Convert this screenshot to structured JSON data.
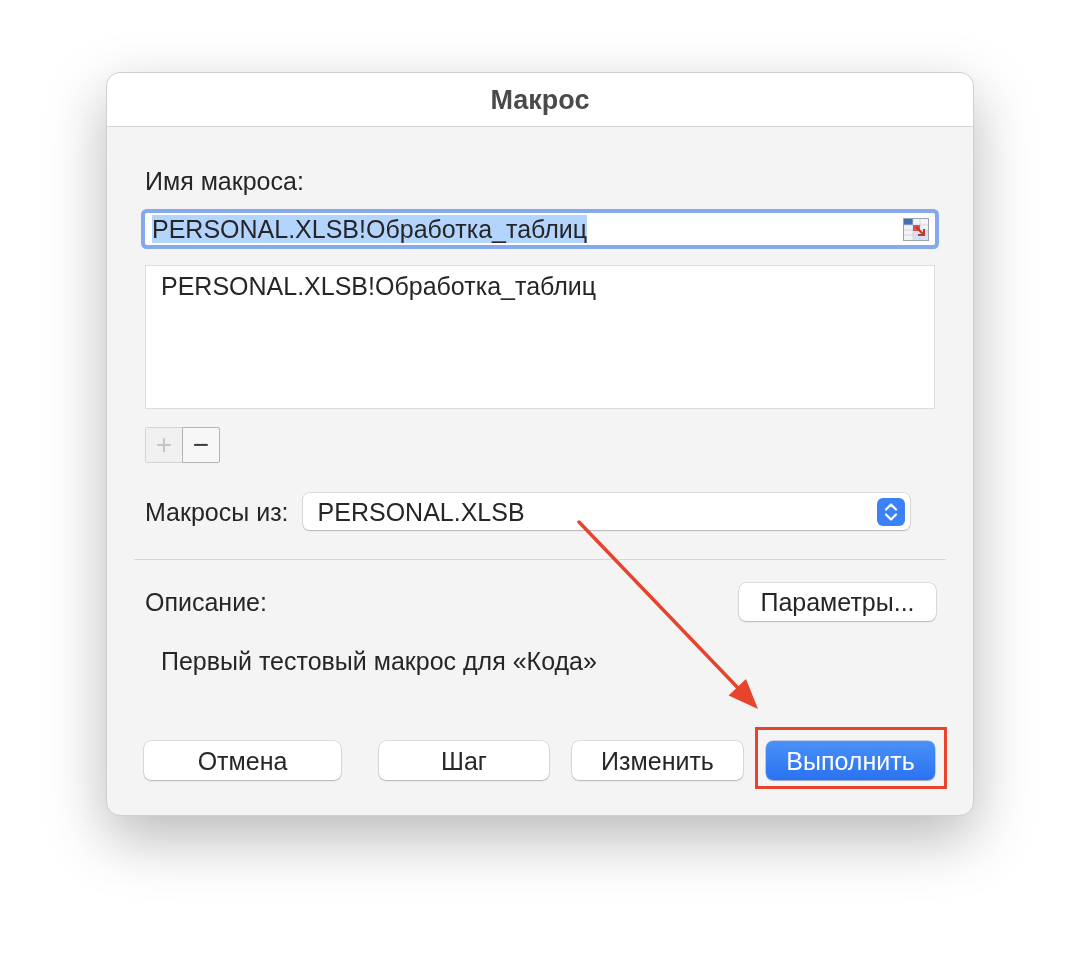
{
  "window": {
    "title": "Макрос"
  },
  "macro_name": {
    "label": "Имя макроса:",
    "value": "PERSONAL.XLSB!Обработка_таблиц",
    "text_selected": true
  },
  "macro_list": {
    "items": [
      {
        "label": "PERSONAL.XLSB!Обработка_таблиц",
        "selected": false
      }
    ]
  },
  "list_buttons": [
    {
      "kind": "add",
      "label": "+",
      "disabled": true
    },
    {
      "kind": "remove",
      "label": "−",
      "disabled": false
    }
  ],
  "macros_in": {
    "label": "Макросы из:",
    "value": "PERSONAL.XLSB"
  },
  "description": {
    "label": "Описание:",
    "text": "Первый тестовый макрос для «Кода»"
  },
  "options_button": {
    "label": "Параметры..."
  },
  "buttons": [
    {
      "label": "Отмена",
      "default": false,
      "highlighted": false
    },
    {
      "label": "Шаг",
      "default": false,
      "highlighted": false
    },
    {
      "label": "Изменить",
      "default": false,
      "highlighted": false
    },
    {
      "label": "Выполнить",
      "default": true,
      "highlighted": true
    }
  ]
}
